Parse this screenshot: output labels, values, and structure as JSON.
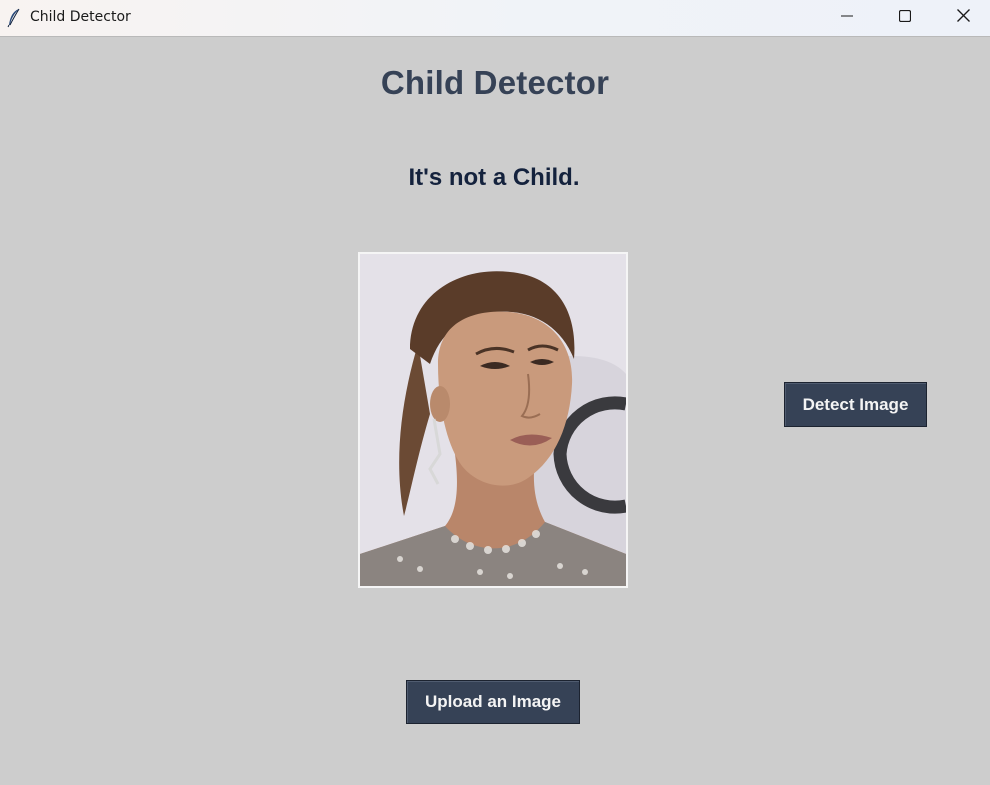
{
  "window": {
    "title": "Child Detector",
    "app_icon": "feather-icon",
    "controls": [
      "minimize-icon",
      "maximize-icon",
      "close-icon"
    ]
  },
  "main": {
    "heading": "Child Detector",
    "result_text": "It's not a Child.",
    "uploaded_image_description": "photo"
  },
  "buttons": {
    "detect_label": "Detect Image",
    "upload_label": "Upload an Image"
  },
  "colors": {
    "background": "#cdcdcd",
    "heading": "#364256",
    "result_text": "#14223d",
    "button_bg": "#364256",
    "button_text": "#f4f4f4"
  }
}
